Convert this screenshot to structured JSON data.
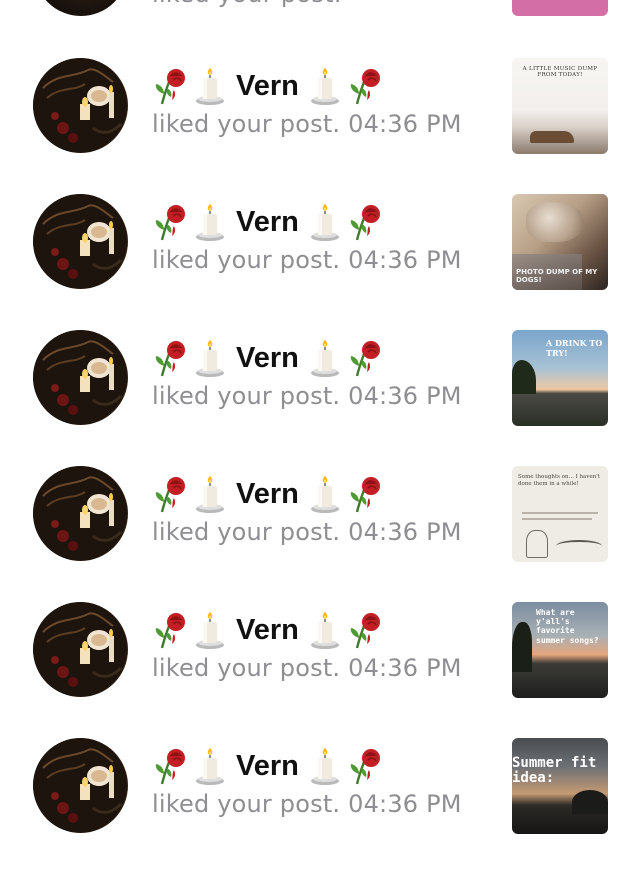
{
  "notifications": [
    {
      "emoji_before": [
        "rose-icon",
        "candle-icon"
      ],
      "name": "Vern",
      "emoji_after": [
        "candle-icon",
        "rose-icon"
      ],
      "action": "liked your post.",
      "time": "04:36 PM",
      "thumb": {
        "kind": "text-card",
        "text": "A LITTLE MUSIC DUMP FROM TODAY!"
      }
    },
    {
      "emoji_before": [
        "rose-icon",
        "candle-icon"
      ],
      "name": "Vern",
      "emoji_after": [
        "candle-icon",
        "rose-icon"
      ],
      "action": "liked your post.",
      "time": "04:36 PM",
      "thumb": {
        "kind": "dog-photo",
        "text": "PHOTO DUMP OF MY DOGS!"
      }
    },
    {
      "emoji_before": [
        "rose-icon",
        "candle-icon"
      ],
      "name": "Vern",
      "emoji_after": [
        "candle-icon",
        "rose-icon"
      ],
      "action": "liked your post.",
      "time": "04:36 PM",
      "thumb": {
        "kind": "sky-photo",
        "text": "A DRINK TO TRY!"
      }
    },
    {
      "emoji_before": [
        "rose-icon",
        "candle-icon"
      ],
      "name": "Vern",
      "emoji_after": [
        "candle-icon",
        "rose-icon"
      ],
      "action": "liked your post.",
      "time": "04:36 PM",
      "thumb": {
        "kind": "sketch-card",
        "text": "Some thoughts on... I haven't done them in a while!"
      }
    },
    {
      "emoji_before": [
        "rose-icon",
        "candle-icon"
      ],
      "name": "Vern",
      "emoji_after": [
        "candle-icon",
        "rose-icon"
      ],
      "action": "liked your post.",
      "time": "04:36 PM",
      "thumb": {
        "kind": "sunset-photo",
        "text": "What are y'all's favorite summer songs?"
      }
    },
    {
      "emoji_before": [
        "rose-icon",
        "candle-icon"
      ],
      "name": "Vern",
      "emoji_after": [
        "candle-icon",
        "rose-icon"
      ],
      "action": "liked your post.",
      "time": "04:36 PM",
      "thumb": {
        "kind": "cloud-photo",
        "text": "Summer fit idea:"
      }
    }
  ],
  "top_partial": {
    "action": "liked your post."
  }
}
